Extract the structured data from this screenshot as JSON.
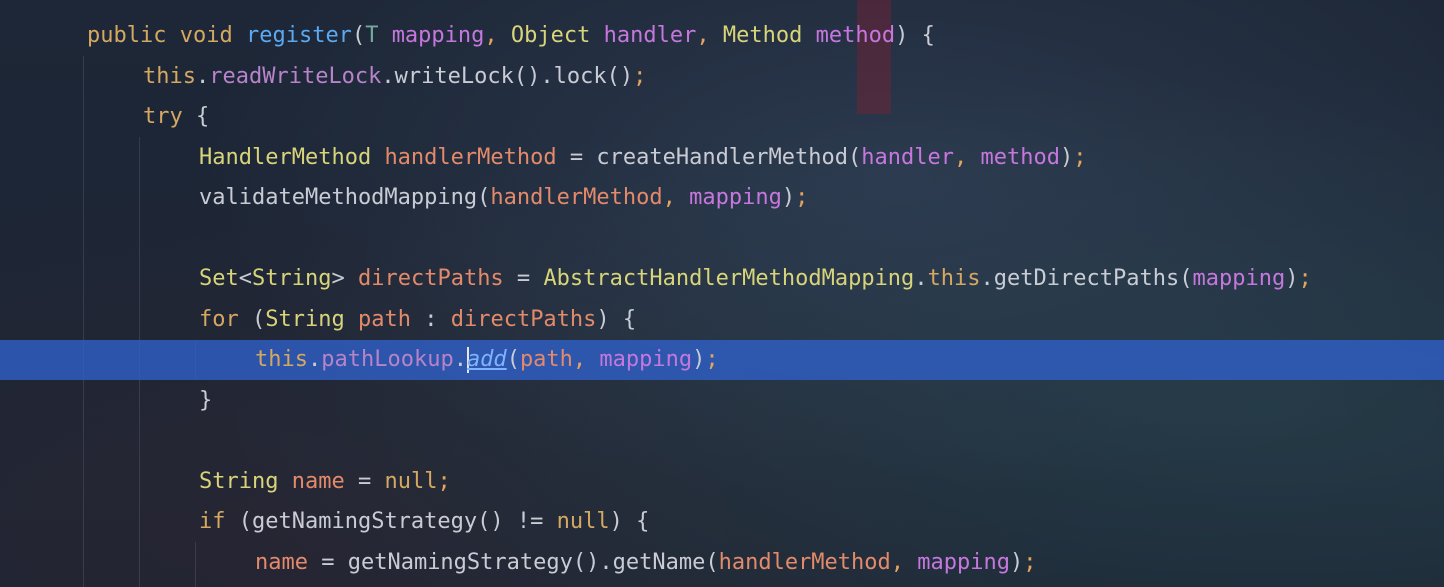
{
  "editor": {
    "current_line": 8,
    "caret_after_text": "this.pathLookup.",
    "colors": {
      "keyword": "#d5a862",
      "type": "#d8d47a",
      "method_declaration": "#5aa9f2",
      "parameter": "#c677dd",
      "local_variable": "#e38a6a",
      "field": "#b783c9",
      "highlight": "#3060c8"
    },
    "lines": [
      {
        "indent": 0,
        "tokens": [
          {
            "t": "public",
            "c": "kw"
          },
          {
            "t": " ",
            "c": "pu"
          },
          {
            "t": "void",
            "c": "kw"
          },
          {
            "t": " ",
            "c": "pu"
          },
          {
            "t": "register",
            "c": "fn"
          },
          {
            "t": "(",
            "c": "pu"
          },
          {
            "t": "T",
            "c": "tp"
          },
          {
            "t": " ",
            "c": "pu"
          },
          {
            "t": "mapping",
            "c": "prm"
          },
          {
            "t": ", ",
            "c": "ps"
          },
          {
            "t": "Object",
            "c": "ty"
          },
          {
            "t": " ",
            "c": "pu"
          },
          {
            "t": "handler",
            "c": "prm"
          },
          {
            "t": ", ",
            "c": "ps"
          },
          {
            "t": "Method",
            "c": "ty"
          },
          {
            "t": " ",
            "c": "pu"
          },
          {
            "t": "method",
            "c": "prm"
          },
          {
            "t": ") {",
            "c": "pu"
          }
        ]
      },
      {
        "indent": 1,
        "tokens": [
          {
            "t": "this",
            "c": "kw"
          },
          {
            "t": ".",
            "c": "pu"
          },
          {
            "t": "readWriteLock",
            "c": "fld"
          },
          {
            "t": ".writeLock().lock()",
            "c": "cal"
          },
          {
            "t": ";",
            "c": "ps"
          }
        ]
      },
      {
        "indent": 1,
        "tokens": [
          {
            "t": "try",
            "c": "kw"
          },
          {
            "t": " {",
            "c": "pu"
          }
        ]
      },
      {
        "indent": 2,
        "tokens": [
          {
            "t": "HandlerMethod",
            "c": "ty"
          },
          {
            "t": " ",
            "c": "pu"
          },
          {
            "t": "handlerMethod",
            "c": "var"
          },
          {
            "t": " = createHandlerMethod(",
            "c": "cal"
          },
          {
            "t": "handler",
            "c": "prm"
          },
          {
            "t": ", ",
            "c": "ps"
          },
          {
            "t": "method",
            "c": "prm"
          },
          {
            "t": ")",
            "c": "pu"
          },
          {
            "t": ";",
            "c": "ps"
          }
        ]
      },
      {
        "indent": 2,
        "tokens": [
          {
            "t": "validateMethodMapping(",
            "c": "cal"
          },
          {
            "t": "handlerMethod",
            "c": "var"
          },
          {
            "t": ", ",
            "c": "ps"
          },
          {
            "t": "mapping",
            "c": "prm"
          },
          {
            "t": ")",
            "c": "pu"
          },
          {
            "t": ";",
            "c": "ps"
          }
        ]
      },
      {
        "indent": 2,
        "tokens": []
      },
      {
        "indent": 2,
        "tokens": [
          {
            "t": "Set",
            "c": "ty"
          },
          {
            "t": "<",
            "c": "pu"
          },
          {
            "t": "String",
            "c": "ty"
          },
          {
            "t": "> ",
            "c": "pu"
          },
          {
            "t": "directPaths",
            "c": "var"
          },
          {
            "t": " = ",
            "c": "pu"
          },
          {
            "t": "AbstractHandlerMethodMapping",
            "c": "ty"
          },
          {
            "t": ".",
            "c": "pu"
          },
          {
            "t": "this",
            "c": "kw"
          },
          {
            "t": ".getDirectPaths(",
            "c": "cal"
          },
          {
            "t": "mapping",
            "c": "prm"
          },
          {
            "t": ")",
            "c": "pu"
          },
          {
            "t": ";",
            "c": "ps"
          }
        ]
      },
      {
        "indent": 2,
        "tokens": [
          {
            "t": "for",
            "c": "kw"
          },
          {
            "t": " (",
            "c": "pu"
          },
          {
            "t": "String",
            "c": "ty"
          },
          {
            "t": " ",
            "c": "pu"
          },
          {
            "t": "path",
            "c": "var"
          },
          {
            "t": " : ",
            "c": "pu"
          },
          {
            "t": "directPaths",
            "c": "var"
          },
          {
            "t": ") {",
            "c": "pu"
          }
        ]
      },
      {
        "indent": 3,
        "tokens": [
          {
            "t": "this",
            "c": "kw"
          },
          {
            "t": ".",
            "c": "pu"
          },
          {
            "t": "pathLookup",
            "c": "fld"
          },
          {
            "t": ".",
            "c": "pu"
          },
          {
            "t": "add",
            "c": "it"
          },
          {
            "t": "(",
            "c": "pu"
          },
          {
            "t": "path",
            "c": "var"
          },
          {
            "t": ", ",
            "c": "ps"
          },
          {
            "t": "mapping",
            "c": "prm"
          },
          {
            "t": ")",
            "c": "pu"
          },
          {
            "t": ";",
            "c": "ps"
          }
        ]
      },
      {
        "indent": 2,
        "tokens": [
          {
            "t": "}",
            "c": "pu"
          }
        ]
      },
      {
        "indent": 2,
        "tokens": []
      },
      {
        "indent": 2,
        "tokens": [
          {
            "t": "String",
            "c": "ty"
          },
          {
            "t": " ",
            "c": "pu"
          },
          {
            "t": "name",
            "c": "var"
          },
          {
            "t": " = ",
            "c": "pu"
          },
          {
            "t": "null",
            "c": "kw"
          },
          {
            "t": ";",
            "c": "ps"
          }
        ]
      },
      {
        "indent": 2,
        "tokens": [
          {
            "t": "if",
            "c": "kw"
          },
          {
            "t": " (getNamingStrategy() != ",
            "c": "cal"
          },
          {
            "t": "null",
            "c": "kw"
          },
          {
            "t": ") {",
            "c": "pu"
          }
        ]
      },
      {
        "indent": 3,
        "tokens": [
          {
            "t": "name",
            "c": "var"
          },
          {
            "t": " = getNamingStrategy().getName(",
            "c": "cal"
          },
          {
            "t": "handlerMethod",
            "c": "var"
          },
          {
            "t": ", ",
            "c": "ps"
          },
          {
            "t": "mapping",
            "c": "prm"
          },
          {
            "t": ")",
            "c": "pu"
          },
          {
            "t": ";",
            "c": "ps"
          }
        ]
      }
    ]
  }
}
